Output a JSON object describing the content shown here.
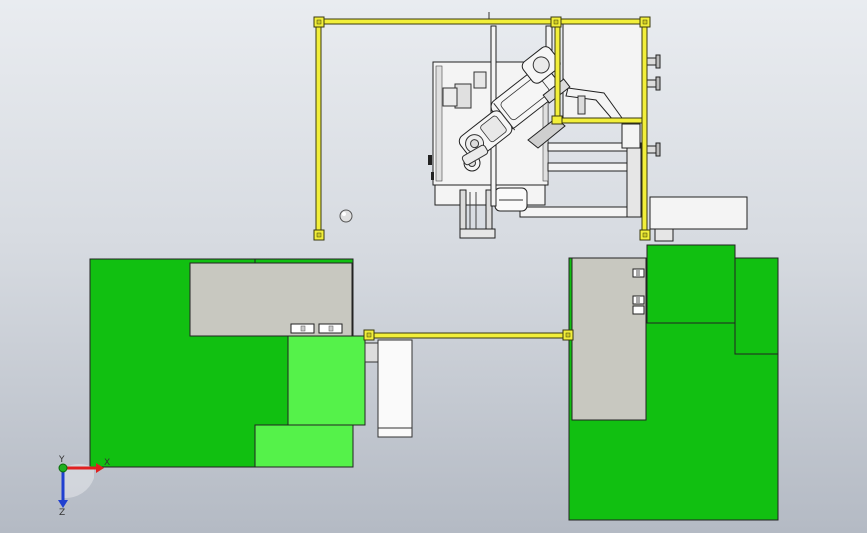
{
  "viewport": {
    "background_top": "#e9ecf0",
    "background_bottom": "#b4bac4"
  },
  "colors": {
    "frame_yellow": "#f2ef3a",
    "frame_outline": "#3a3a10",
    "machine_green": "#11c011",
    "machine_green_light": "#55f24a",
    "plate_gray": "#c8c8c0",
    "robot_white": "#f4f4f4",
    "edge": "#222222",
    "axis_x": "#e02020",
    "axis_y": "#20b020",
    "axis_z": "#2040d0"
  },
  "triad": {
    "x_label": "X",
    "y_label": "Y",
    "z_label": "Z",
    "icon": "coordinate-triad-icon"
  }
}
